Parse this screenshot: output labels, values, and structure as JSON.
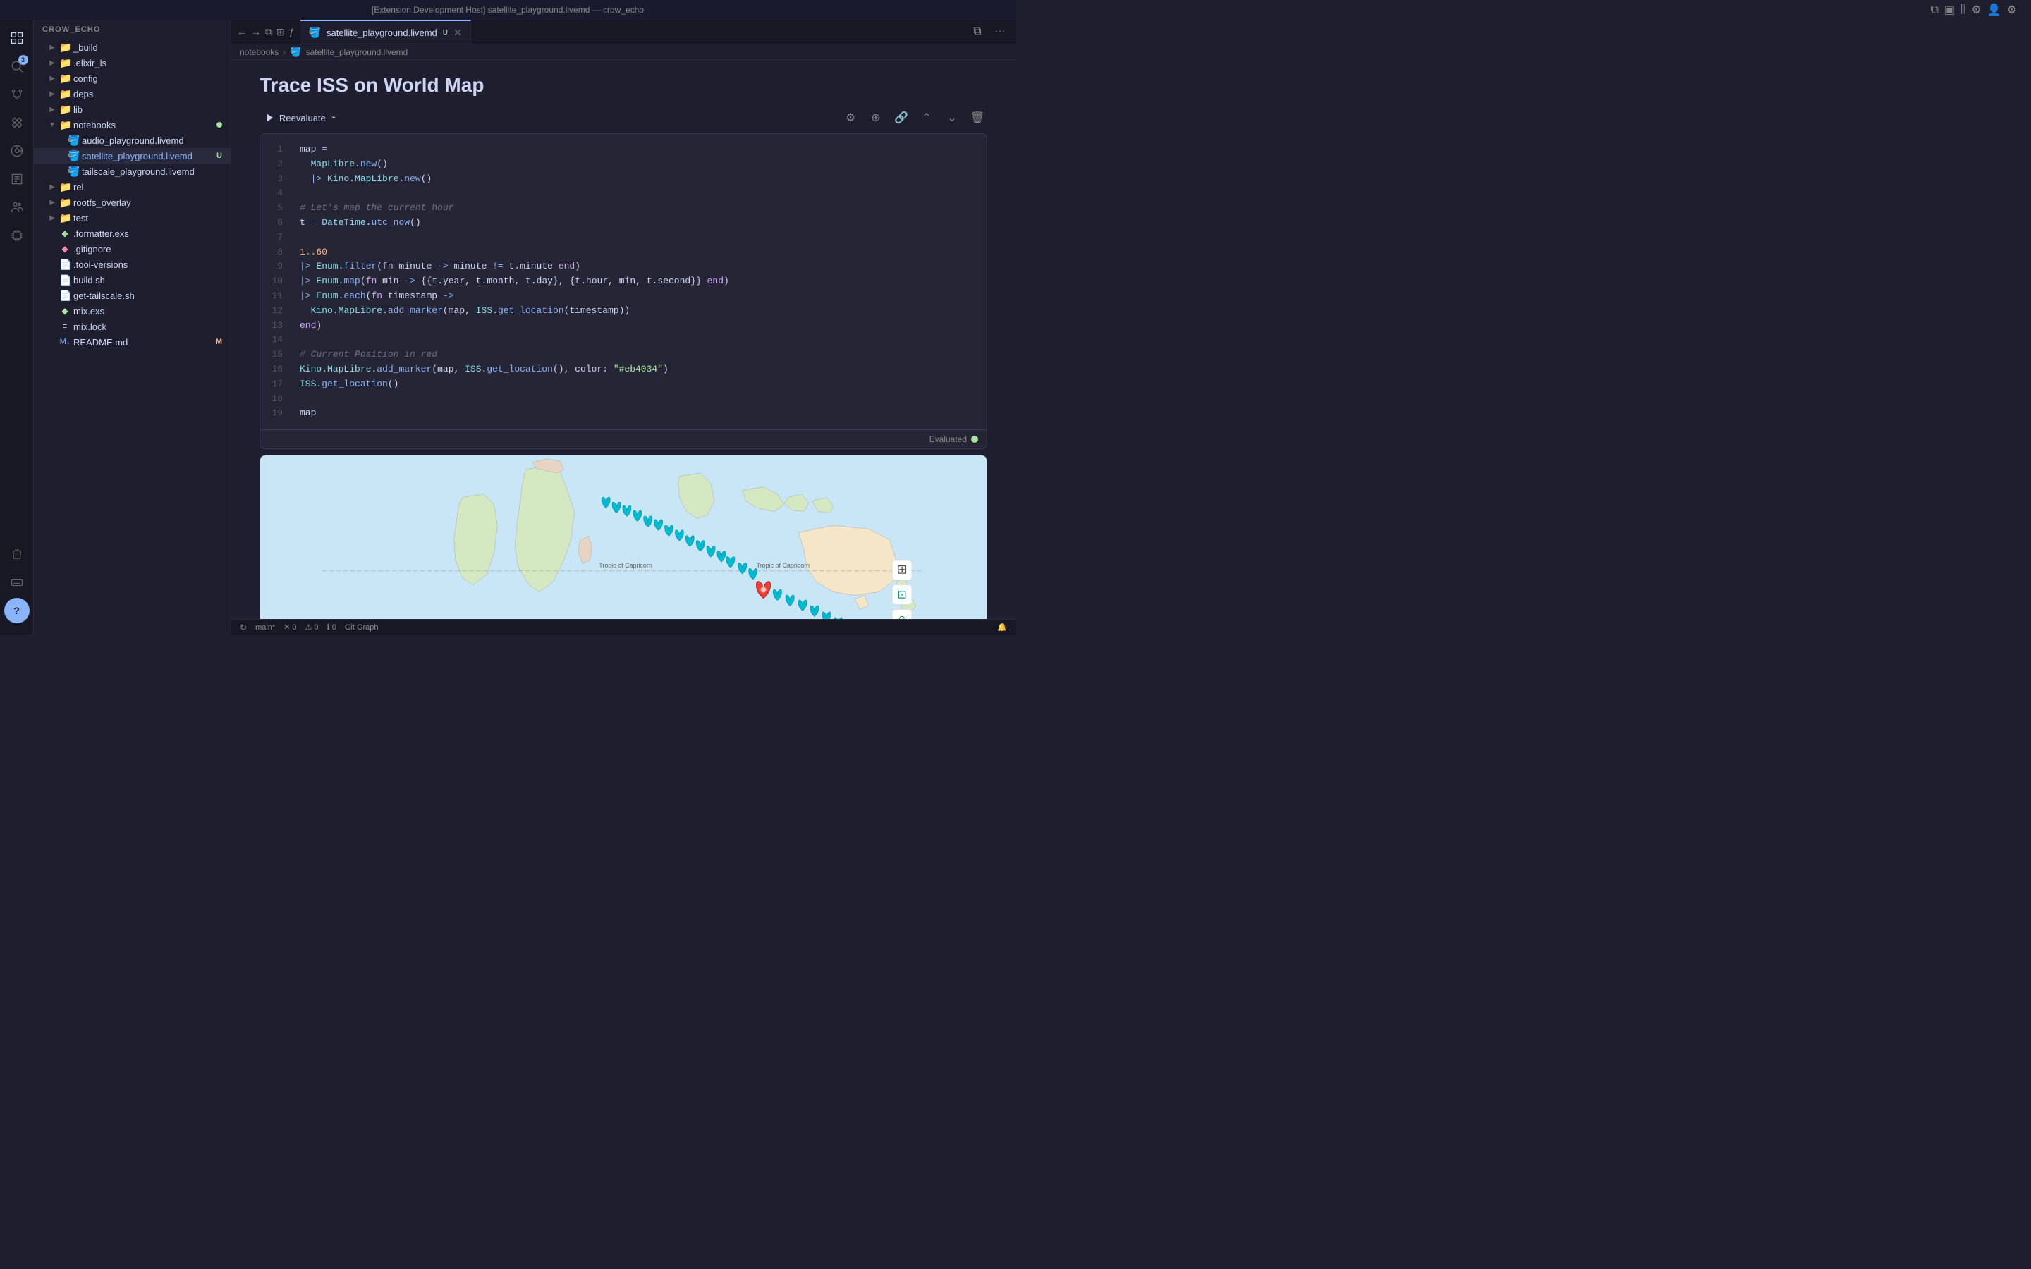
{
  "title_bar": {
    "text": "[Extension Development Host] satellite_playground.livemd — crow_echo"
  },
  "sidebar": {
    "header": "CROW_ECHO",
    "items": [
      {
        "id": "_build",
        "label": "_build",
        "type": "folder",
        "indent": 1,
        "collapsed": true
      },
      {
        "id": "_elixir_ls",
        "label": ".elixir_ls",
        "type": "folder",
        "indent": 1,
        "collapsed": true
      },
      {
        "id": "config",
        "label": "config",
        "type": "folder",
        "indent": 1,
        "collapsed": true
      },
      {
        "id": "deps",
        "label": "deps",
        "type": "folder",
        "indent": 1,
        "collapsed": true
      },
      {
        "id": "lib",
        "label": "lib",
        "type": "folder",
        "indent": 1,
        "collapsed": true
      },
      {
        "id": "notebooks",
        "label": "notebooks",
        "type": "folder",
        "indent": 1,
        "collapsed": false,
        "badge": "dot"
      },
      {
        "id": "audio_playground",
        "label": "audio_playground.livemd",
        "type": "notebook",
        "indent": 2
      },
      {
        "id": "satellite_playground",
        "label": "satellite_playground.livemd",
        "type": "notebook-active",
        "indent": 2,
        "badge": "U"
      },
      {
        "id": "tailscale_playground",
        "label": "tailscale_playground.livemd",
        "type": "notebook",
        "indent": 2
      },
      {
        "id": "rel",
        "label": "rel",
        "type": "folder",
        "indent": 1,
        "collapsed": true
      },
      {
        "id": "rootfs_overlay",
        "label": "rootfs_overlay",
        "type": "folder",
        "indent": 1,
        "collapsed": true
      },
      {
        "id": "test",
        "label": "test",
        "type": "folder",
        "indent": 1,
        "collapsed": true
      },
      {
        "id": "formatter_exs",
        "label": ".formatter.exs",
        "type": "elixir",
        "indent": 1
      },
      {
        "id": "gitignore",
        "label": ".gitignore",
        "type": "git",
        "indent": 1
      },
      {
        "id": "tool-versions",
        "label": ".tool-versions",
        "type": "file",
        "indent": 1
      },
      {
        "id": "build_sh",
        "label": "build.sh",
        "type": "file",
        "indent": 1
      },
      {
        "id": "get-tailscale",
        "label": "get-tailscale.sh",
        "type": "file",
        "indent": 1
      },
      {
        "id": "mix_exs",
        "label": "mix.exs",
        "type": "elixir-mix",
        "indent": 1
      },
      {
        "id": "mix_lock",
        "label": "mix.lock",
        "type": "list",
        "indent": 1
      },
      {
        "id": "readme_md",
        "label": "README.md",
        "type": "markdown",
        "indent": 1,
        "badge": "M"
      }
    ]
  },
  "tab": {
    "title": "satellite_playground.livemd",
    "icon": "🪣"
  },
  "breadcrumb": {
    "parts": [
      "notebooks",
      "satellite_playground.livemd"
    ]
  },
  "notebook": {
    "title": "Trace ISS on World Map",
    "reevaluate_label": "Reevaluate",
    "cell_footer": "Evaluated",
    "code_lines": [
      {
        "num": 1,
        "text": "map = "
      },
      {
        "num": 2,
        "text": "  MapLibre.new()"
      },
      {
        "num": 3,
        "text": "  |> Kino.MapLibre.new()"
      },
      {
        "num": 4,
        "text": ""
      },
      {
        "num": 5,
        "text": "# Let's map the current hour"
      },
      {
        "num": 6,
        "text": "t = DateTime.utc_now()"
      },
      {
        "num": 7,
        "text": ""
      },
      {
        "num": 8,
        "text": "1..60"
      },
      {
        "num": 9,
        "text": "|> Enum.filter(fn minute -> minute != t.minute end)"
      },
      {
        "num": 10,
        "text": "|> Enum.map(fn min -> {{t.year, t.month, t.day}, {t.hour, min, t.second}} end)"
      },
      {
        "num": 11,
        "text": "|> Enum.each(fn timestamp ->"
      },
      {
        "num": 12,
        "text": "  Kino.MapLibre.add_marker(map, ISS.get_location(timestamp))"
      },
      {
        "num": 13,
        "text": "end)"
      },
      {
        "num": 14,
        "text": ""
      },
      {
        "num": 15,
        "text": "# Current Position in red"
      },
      {
        "num": 16,
        "text": "Kino.MapLibre.add_marker(map, ISS.get_location(), color: \"#eb4034\")"
      },
      {
        "num": 17,
        "text": "ISS.get_location()"
      },
      {
        "num": 18,
        "text": ""
      },
      {
        "num": 19,
        "text": "map"
      }
    ]
  },
  "status_bar": {
    "branch": "main*",
    "errors": "0",
    "warnings": "0",
    "info": "0",
    "git_label": "Git Graph"
  },
  "map": {
    "tropic_label_1": "Tropic of Capricorn",
    "tropic_label_2": "Tropic of Capricorn"
  }
}
